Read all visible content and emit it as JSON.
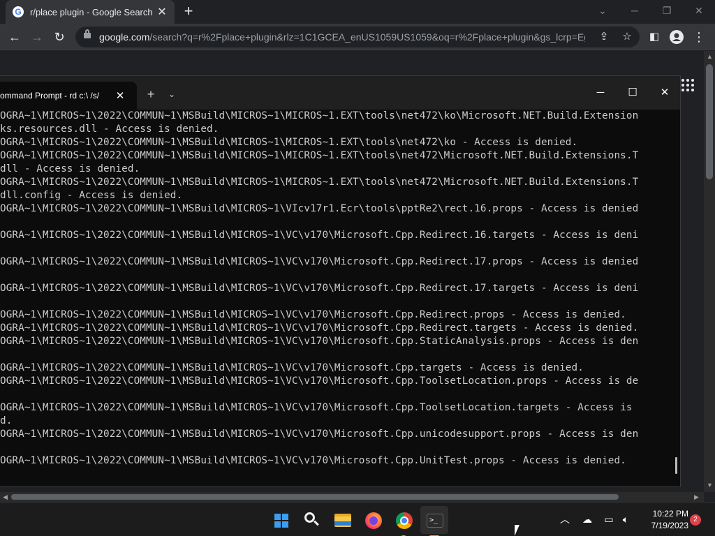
{
  "chrome": {
    "tab_title": "r/place plugin - Google Search",
    "url_host": "google.com",
    "url_rest": "/search?q=r%2Fplace+plugin&rlz=1C1GCEA_enUS1059US1059&oq=r%2Fplace+plugin&gs_lcrp=Eg..."
  },
  "terminal": {
    "tab_title": "ommand Prompt - rd  c:\\ /s/",
    "lines": [
      "OGRA~1\\MICROS~1\\2022\\COMMUN~1\\MSBuild\\MICROS~1\\MICROS~1.EXT\\tools\\net472\\ko\\Microsoft.NET.Build.Extension",
      "ks.resources.dll - Access is denied.",
      "OGRA~1\\MICROS~1\\2022\\COMMUN~1\\MSBuild\\MICROS~1\\MICROS~1.EXT\\tools\\net472\\ko - Access is denied.",
      "OGRA~1\\MICROS~1\\2022\\COMMUN~1\\MSBuild\\MICROS~1\\MICROS~1.EXT\\tools\\net472\\Microsoft.NET.Build.Extensions.T",
      "dll - Access is denied.",
      "OGRA~1\\MICROS~1\\2022\\COMMUN~1\\MSBuild\\MICROS~1\\MICROS~1.EXT\\tools\\net472\\Microsoft.NET.Build.Extensions.T",
      "dll.config - Access is denied.",
      "OGRA~1\\MICROS~1\\2022\\COMMUN~1\\MSBuild\\MICROS~1\\VIcv17r1.Ecr\\tools\\pptRe2\\rect.16.props - Access is denied",
      "",
      "OGRA~1\\MICROS~1\\2022\\COMMUN~1\\MSBuild\\MICROS~1\\VC\\v170\\Microsoft.Cpp.Redirect.16.targets - Access is deni",
      "",
      "OGRA~1\\MICROS~1\\2022\\COMMUN~1\\MSBuild\\MICROS~1\\VC\\v170\\Microsoft.Cpp.Redirect.17.props - Access is denied",
      "",
      "OGRA~1\\MICROS~1\\2022\\COMMUN~1\\MSBuild\\MICROS~1\\VC\\v170\\Microsoft.Cpp.Redirect.17.targets - Access is deni",
      "",
      "OGRA~1\\MICROS~1\\2022\\COMMUN~1\\MSBuild\\MICROS~1\\VC\\v170\\Microsoft.Cpp.Redirect.props - Access is denied.",
      "OGRA~1\\MICROS~1\\2022\\COMMUN~1\\MSBuild\\MICROS~1\\VC\\v170\\Microsoft.Cpp.Redirect.targets - Access is denied.",
      "OGRA~1\\MICROS~1\\2022\\COMMUN~1\\MSBuild\\MICROS~1\\VC\\v170\\Microsoft.Cpp.StaticAnalysis.props - Access is den",
      "",
      "OGRA~1\\MICROS~1\\2022\\COMMUN~1\\MSBuild\\MICROS~1\\VC\\v170\\Microsoft.Cpp.targets - Access is denied.",
      "OGRA~1\\MICROS~1\\2022\\COMMUN~1\\MSBuild\\MICROS~1\\VC\\v170\\Microsoft.Cpp.ToolsetLocation.props - Access is de",
      "",
      "OGRA~1\\MICROS~1\\2022\\COMMUN~1\\MSBuild\\MICROS~1\\VC\\v170\\Microsoft.Cpp.ToolsetLocation.targets - Access is",
      "d.",
      "OGRA~1\\MICROS~1\\2022\\COMMUN~1\\MSBuild\\MICROS~1\\VC\\v170\\Microsoft.Cpp.unicodesupport.props - Access is den",
      "",
      "OGRA~1\\MICROS~1\\2022\\COMMUN~1\\MSBuild\\MICROS~1\\VC\\v170\\Microsoft.Cpp.UnitTest.props - Access is denied."
    ]
  },
  "taskbar": {
    "time": "10:22 PM",
    "date": "7/19/2023",
    "notification_count": "2"
  },
  "icons": {
    "back": "arrow-left-icon",
    "forward": "arrow-right-icon",
    "reload": "reload-icon",
    "lock": "lock-icon",
    "share": "share-icon",
    "bookmark": "star-icon",
    "side_panel": "side-panel-icon",
    "profile": "profile-icon",
    "menu": "kebab-menu-icon",
    "apps": "apps-grid-icon"
  },
  "colors": {
    "chrome_frame": "#202124",
    "chrome_toolbar": "#35363a",
    "terminal_bg": "#0c0c0c",
    "terminal_text": "#cccccc",
    "taskbar_bg": "#1c1c1c",
    "terminal_running_indicator": "#ff8a65"
  }
}
